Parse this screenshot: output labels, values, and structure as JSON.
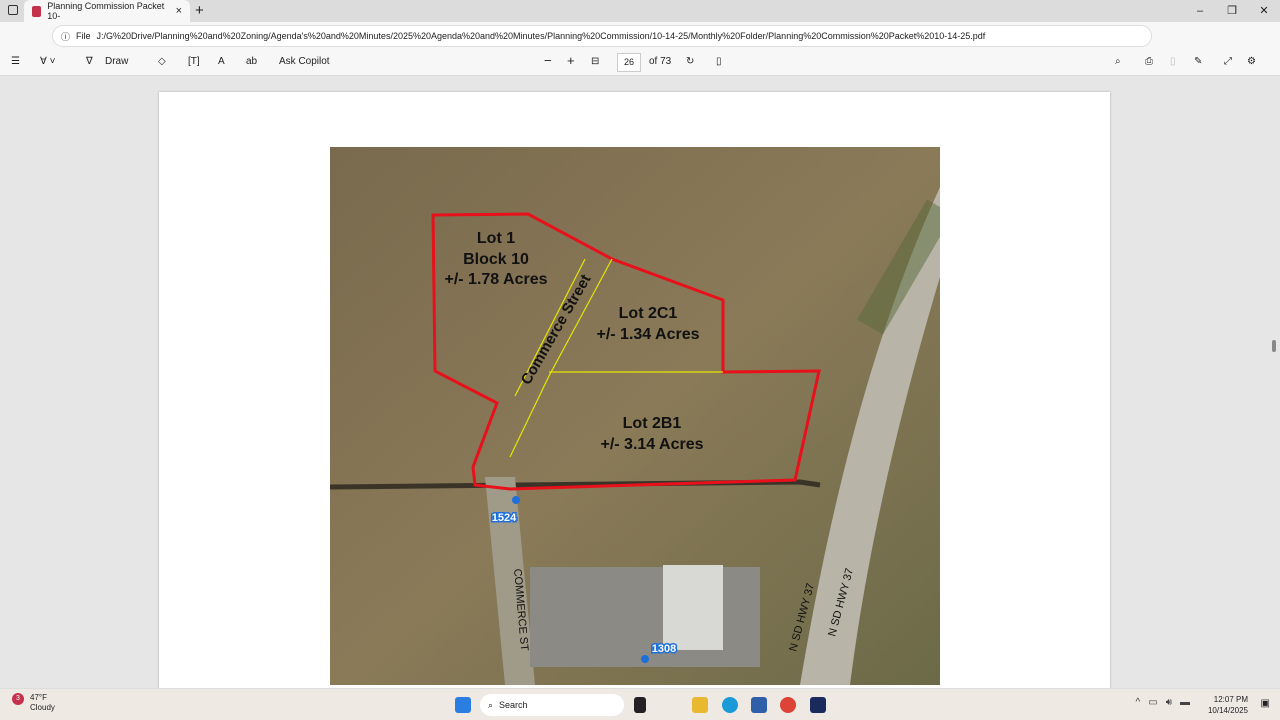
{
  "browser": {
    "tab_title": "Planning Commission Packet 10-",
    "address_prefix": "File",
    "url": "J:/G%20Drive/Planning%20and%20Zoning/Agenda's%20and%20Minutes/2025%20Agenda%20and%20Minutes/Planning%20Commission/10-14-25/Monthly%20Folder/Planning%20Commission%20Packet%2010-14-25.pdf"
  },
  "pdf_toolbar": {
    "draw_label": "Draw",
    "ask_copilot": "Ask Copilot",
    "page_number": "26",
    "page_total": "of 73"
  },
  "map": {
    "lot1": [
      "Lot 1",
      "Block 10",
      "+/- 1.78 Acres"
    ],
    "lot2c1": [
      "Lot 2C1",
      "+/- 1.34 Acres"
    ],
    "lot2b1": [
      "Lot 2B1",
      "+/- 3.14 Acres"
    ],
    "street": "Commerce Street",
    "address1": "1524",
    "address2": "1308",
    "road1": "COMMERCE ST",
    "road2": "N SD HWY 37",
    "road3": "N SD HWY 37",
    "colors": {
      "boundary": "#e8101a",
      "inner_line": "#e6e600",
      "address_dot": "#1e6fd9"
    }
  },
  "taskbar": {
    "temp": "47°F",
    "weather": "Cloudy",
    "weather_badge": "3",
    "search": "Search",
    "time": "12:07 PM",
    "date": "10/14/2025"
  }
}
